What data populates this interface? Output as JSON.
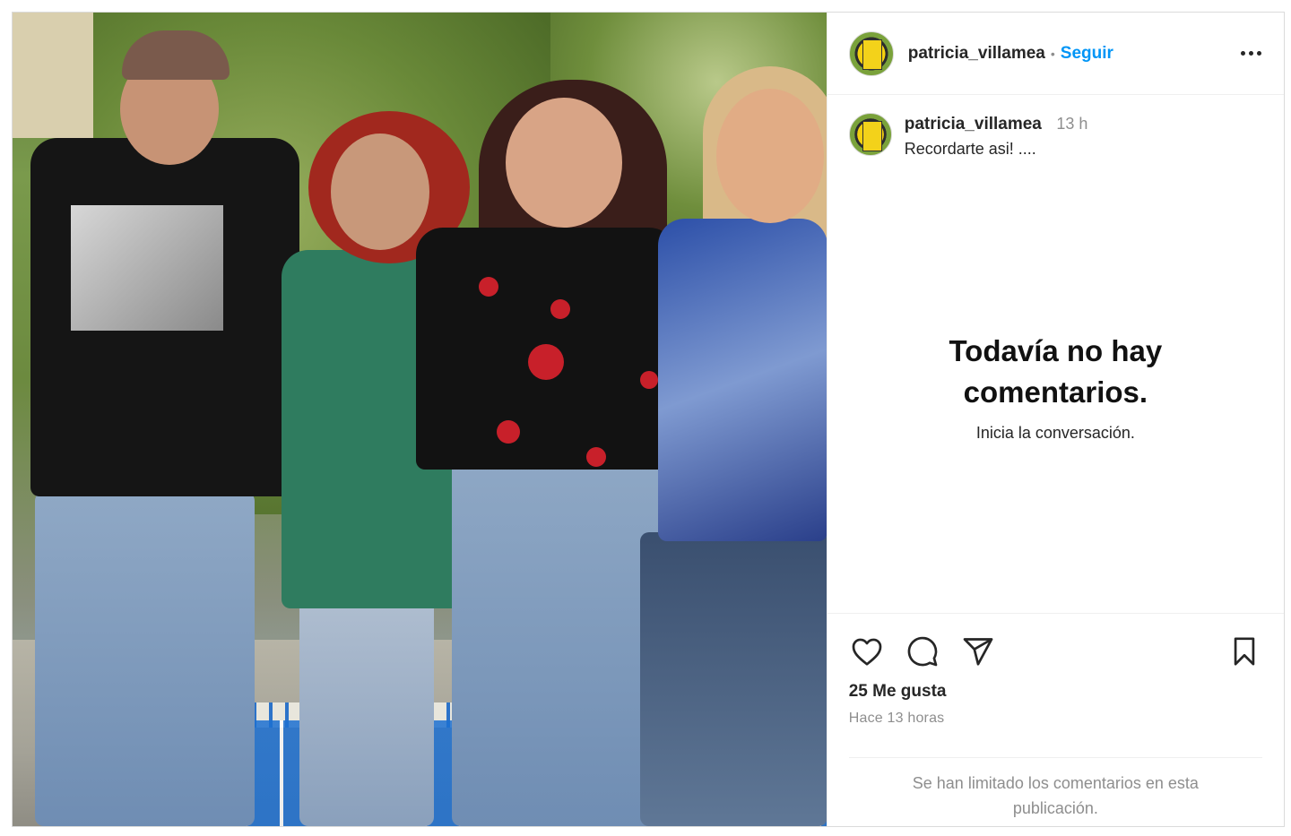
{
  "post": {
    "username": "patricia_villamea",
    "follow_label": "Seguir",
    "dot": "•"
  },
  "caption": {
    "username": "patricia_villamea",
    "time": "13 h",
    "text": "Recordarte asi! ...."
  },
  "comments": {
    "empty_title_line1": "Todavía no hay",
    "empty_title_line2": "comentarios.",
    "empty_subtitle": "Inicia la conversación."
  },
  "actions": {
    "icons": [
      "heart-icon",
      "comment-icon",
      "share-icon",
      "bookmark-icon"
    ]
  },
  "stats": {
    "likes": "25 Me gusta",
    "posted_ago": "Hace 13 horas"
  },
  "footer": {
    "limited_notice_line1": "Se han limitado los comentarios en esta",
    "limited_notice_line2": "publicación."
  },
  "colors": {
    "link_blue": "#0095f6",
    "text": "#262626",
    "muted": "#8e8e8e",
    "border": "#dbdbdb"
  }
}
